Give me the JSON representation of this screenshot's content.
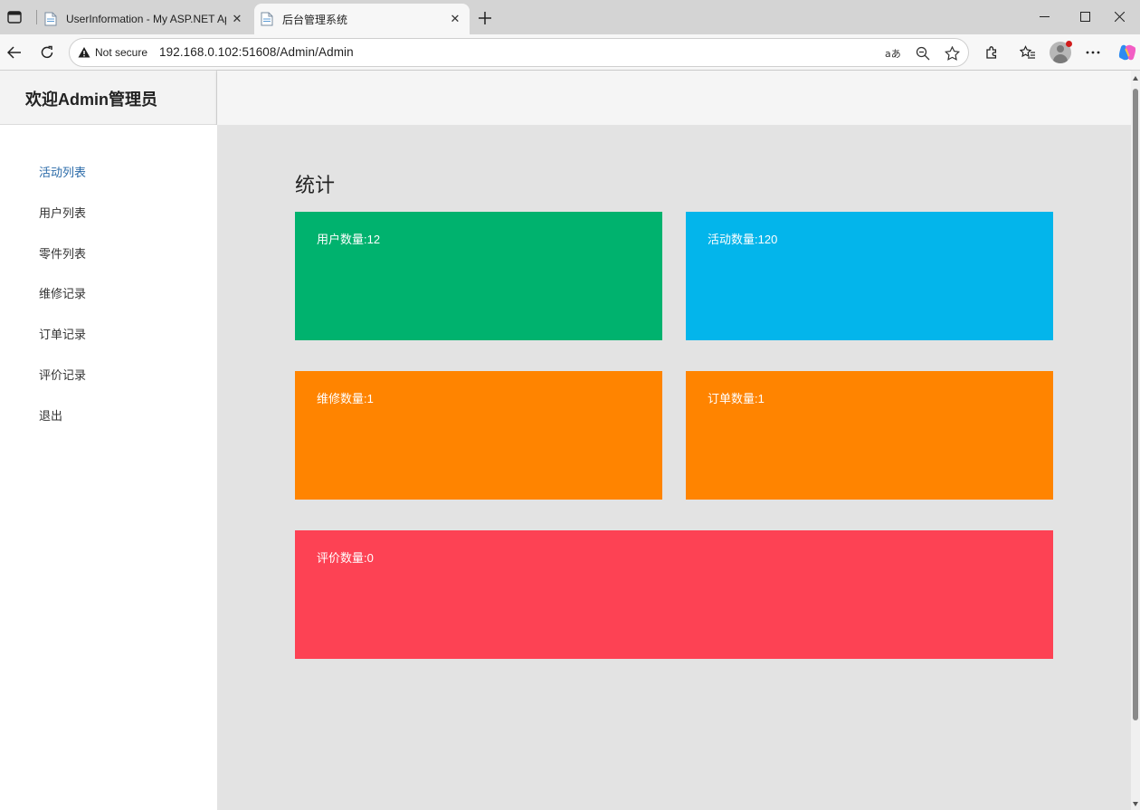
{
  "browser": {
    "tabs": [
      {
        "title": "UserInformation - My ASP.NET Ap",
        "active": false
      },
      {
        "title": "后台管理系统",
        "active": true
      }
    ],
    "security_label": "Not secure",
    "url": "192.168.0.102:51608/Admin/Admin",
    "icons": [
      "tab-actions-icon",
      "page-icon",
      "close-icon",
      "plus-icon",
      "minimize-icon",
      "maximize-icon",
      "window-close-icon",
      "back-icon",
      "reload-icon",
      "warning-icon",
      "read-aloud-icon",
      "zoom-out-icon",
      "favorite-star-icon",
      "extensions-icon",
      "favorites-icon",
      "profile-icon",
      "more-icon",
      "copilot-icon"
    ]
  },
  "header": {
    "title": "欢迎Admin管理员"
  },
  "sidebar": {
    "items": [
      {
        "label": "活动列表",
        "active": true
      },
      {
        "label": "用户列表",
        "active": false
      },
      {
        "label": "零件列表",
        "active": false
      },
      {
        "label": "维修记录",
        "active": false
      },
      {
        "label": "订单记录",
        "active": false
      },
      {
        "label": "评价记录",
        "active": false
      },
      {
        "label": "退出",
        "active": false
      }
    ]
  },
  "main": {
    "section_title": "统计",
    "cards": [
      {
        "label": "用户数量:12",
        "color": "#00b26e"
      },
      {
        "label": "活动数量:120",
        "color": "#03b5eb"
      },
      {
        "label": "维修数量:1",
        "color": "#ff8400"
      },
      {
        "label": "订单数量:1",
        "color": "#ff8400"
      },
      {
        "label": "评价数量:0",
        "color": "#fd4254"
      }
    ]
  },
  "colors": {
    "nav_active": "#2a6aa8",
    "main_bg": "#e3e3e3"
  }
}
